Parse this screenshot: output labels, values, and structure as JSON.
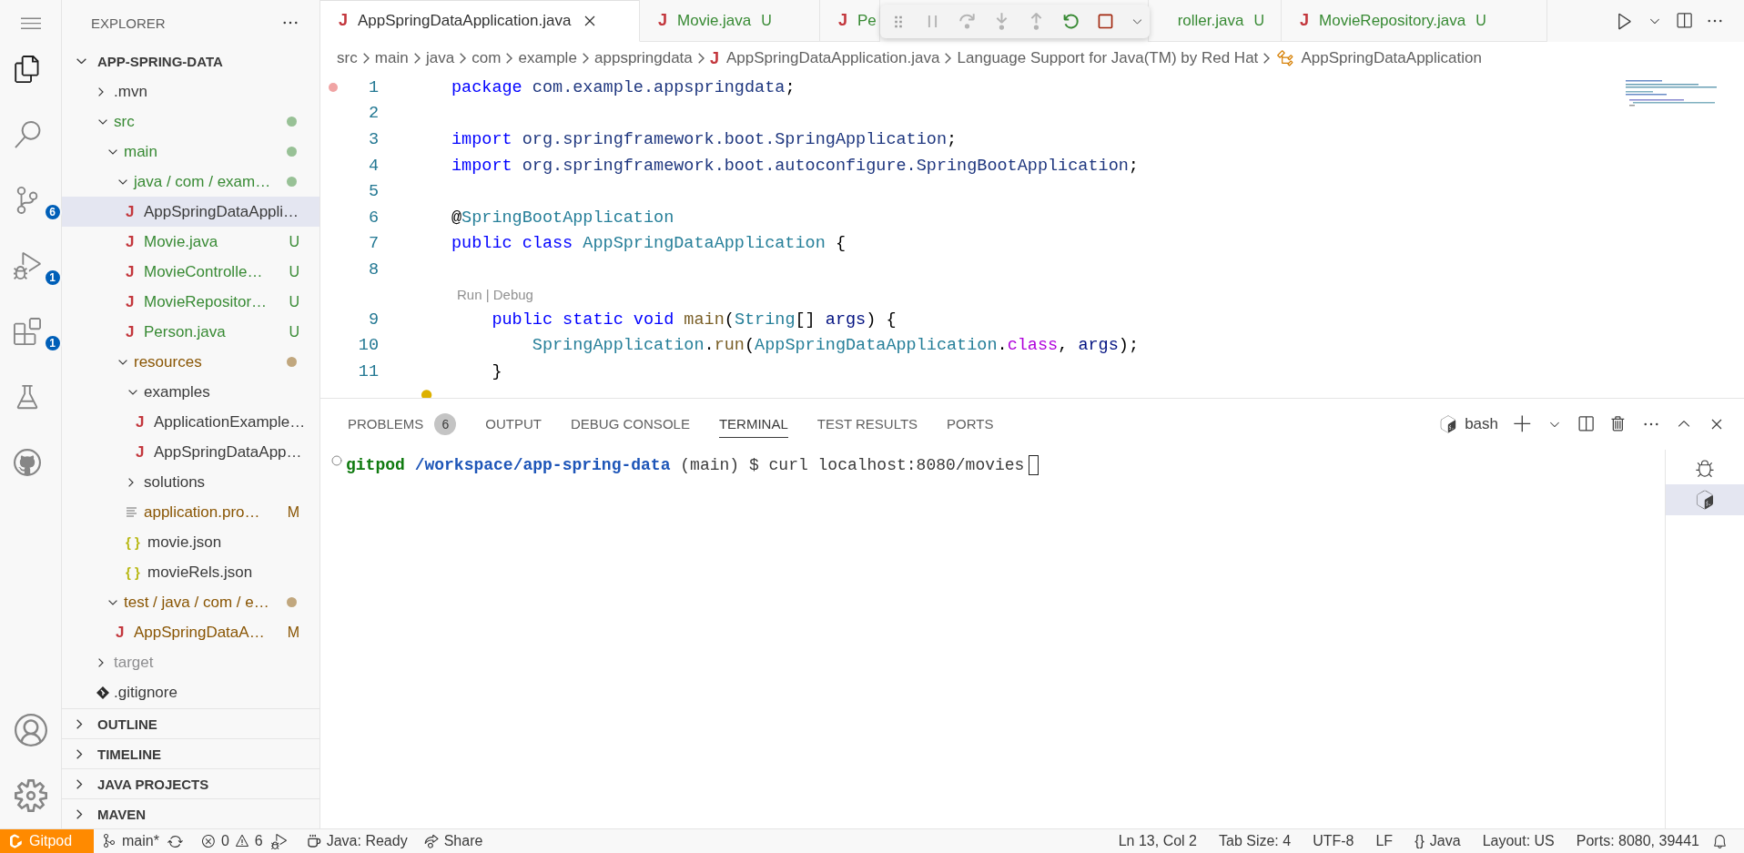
{
  "activity_bar": {
    "items": [
      {
        "kind": "explorer",
        "selected": true
      },
      {
        "kind": "search",
        "selected": false
      },
      {
        "kind": "source_control",
        "selected": false,
        "badge": "6"
      },
      {
        "kind": "run_debug",
        "selected": false,
        "badge": "1"
      },
      {
        "kind": "extensions",
        "selected": false,
        "badge": "1"
      },
      {
        "kind": "testing",
        "selected": false
      },
      {
        "kind": "github",
        "selected": false
      }
    ],
    "bottom": [
      {
        "kind": "accounts"
      },
      {
        "kind": "settings"
      }
    ]
  },
  "explorer": {
    "title": "EXPLORER",
    "root": {
      "label": "APP-SPRING-DATA",
      "expanded": true
    },
    "tree": [
      {
        "kind": "folder",
        "label": ".mvn",
        "expanded": false,
        "selected": false,
        "color": "#3b3b3b",
        "dot": false
      },
      {
        "kind": "folder",
        "label": "src",
        "expanded": true,
        "selected": false,
        "color": "#388a34",
        "dot": true,
        "children": [
          {
            "kind": "folder",
            "label": "main",
            "expanded": true,
            "selected": false,
            "color": "#388a34",
            "dot": true,
            "children": [
              {
                "kind": "folder",
                "label": "java / com / exam…",
                "expanded": true,
                "selected": false,
                "color": "#388a34",
                "dot": true,
                "children": [
                  {
                    "kind": "java",
                    "icon": "J",
                    "label": "AppSpringDataAppli…",
                    "selected": true,
                    "color": "#3b3b3b",
                    "dot": false
                  },
                  {
                    "kind": "java",
                    "icon": "J",
                    "label": "Movie.java",
                    "selected": false,
                    "color": "#388a34",
                    "dot": false,
                    "badge": "U"
                  },
                  {
                    "kind": "java",
                    "icon": "J",
                    "label": "MovieControlle…",
                    "selected": false,
                    "color": "#388a34",
                    "dot": false,
                    "badge": "U"
                  },
                  {
                    "kind": "java",
                    "icon": "J",
                    "label": "MovieRepositor…",
                    "selected": false,
                    "color": "#388a34",
                    "dot": false,
                    "badge": "U"
                  },
                  {
                    "kind": "java",
                    "icon": "J",
                    "label": "Person.java",
                    "selected": false,
                    "color": "#388a34",
                    "dot": false,
                    "badge": "U"
                  }
                ]
              },
              {
                "kind": "folder",
                "label": "resources",
                "expanded": true,
                "selected": false,
                "color": "#895503",
                "dot": true,
                "children": [
                  {
                    "kind": "folder",
                    "label": "examples",
                    "expanded": true,
                    "selected": false,
                    "color": "#3b3b3b",
                    "dot": false,
                    "children": [
                      {
                        "kind": "java",
                        "icon": "J",
                        "label": "ApplicationExample…",
                        "selected": false,
                        "color": "#3b3b3b",
                        "dot": false
                      },
                      {
                        "kind": "java",
                        "icon": "J",
                        "label": "AppSpringDataApp…",
                        "selected": false,
                        "color": "#3b3b3b",
                        "dot": false
                      }
                    ]
                  },
                  {
                    "kind": "folder",
                    "label": "solutions",
                    "expanded": false,
                    "selected": false,
                    "color": "#3b3b3b",
                    "dot": false
                  },
                  {
                    "kind": "properties",
                    "label": "application.pro…",
                    "selected": false,
                    "color": "#895503",
                    "dot": false,
                    "badge": "M"
                  },
                  {
                    "kind": "json",
                    "icon": "{ }",
                    "label": "movie.json",
                    "selected": false,
                    "color": "#3b3b3b",
                    "dot": false
                  },
                  {
                    "kind": "json",
                    "icon": "{ }",
                    "label": "movieRels.json",
                    "selected": false,
                    "color": "#3b3b3b",
                    "dot": false
                  }
                ]
              }
            ]
          },
          {
            "kind": "folder",
            "label": "test / java / com / e…",
            "expanded": true,
            "selected": false,
            "color": "#895503",
            "dot": true,
            "children": [
              {
                "kind": "java",
                "icon": "J",
                "label": "AppSpringDataA…",
                "selected": false,
                "color": "#895503",
                "dot": false,
                "badge": "M"
              }
            ]
          }
        ]
      },
      {
        "kind": "folder",
        "label": "target",
        "expanded": false,
        "selected": false,
        "color": "#8e8e90",
        "dot": false
      },
      {
        "kind": "git",
        "label": ".gitignore",
        "selected": false,
        "color": "#3b3b3b",
        "dot": false
      }
    ],
    "sections": [
      {
        "label": "OUTLINE",
        "expanded": false
      },
      {
        "label": "TIMELINE",
        "expanded": false
      },
      {
        "label": "JAVA PROJECTS",
        "expanded": false
      },
      {
        "label": "MAVEN",
        "expanded": false
      }
    ]
  },
  "tabs": [
    {
      "icon": "J",
      "label": "AppSpringDataApplication.java",
      "selected": true,
      "color": "#333333"
    },
    {
      "icon": "J",
      "label": "Movie.java",
      "badge": "U",
      "selected": false,
      "color": "#388a34"
    },
    {
      "icon": "J",
      "label": "Pe",
      "selected": false,
      "color": "#388a34"
    },
    {
      "label": "roller.java",
      "badge": "U",
      "selected": false,
      "color": "#388a34"
    },
    {
      "icon": "J",
      "label": "MovieRepository.java",
      "badge": "U",
      "selected": false,
      "color": "#388a34"
    }
  ],
  "debug_toolbar": {
    "buttons": [
      {
        "kind": "pause",
        "disabled": true
      },
      {
        "kind": "step_over",
        "disabled": true
      },
      {
        "kind": "step_into",
        "disabled": true
      },
      {
        "kind": "step_out",
        "disabled": true
      },
      {
        "kind": "restart",
        "disabled": false
      },
      {
        "kind": "stop",
        "disabled": false
      }
    ]
  },
  "breadcrumbs": [
    {
      "kind": "segment",
      "label": "src"
    },
    {
      "kind": "segment",
      "label": "main"
    },
    {
      "kind": "segment",
      "label": "java"
    },
    {
      "kind": "segment",
      "label": "com"
    },
    {
      "kind": "segment",
      "label": "example"
    },
    {
      "kind": "segment",
      "label": "appspringdata"
    },
    {
      "kind": "file",
      "icon": "J",
      "label": "AppSpringDataApplication.java"
    },
    {
      "kind": "segment",
      "label": "Language Support for Java(TM) by Red Hat"
    },
    {
      "kind": "symbol",
      "label": "AppSpringDataApplication"
    }
  ],
  "code": [
    {
      "kind": "code",
      "number": "1",
      "breakpoint": true,
      "tokens": [
        {
          "text": "package",
          "kind": "keyword"
        },
        {
          "text": " com.example.appspringdata",
          "kind": "name"
        },
        {
          "text": ";",
          "kind": "plain"
        }
      ]
    },
    {
      "kind": "code",
      "number": "2",
      "breakpoint": false
    },
    {
      "kind": "code",
      "number": "3",
      "breakpoint": false,
      "tokens": [
        {
          "text": "import",
          "kind": "keyword"
        },
        {
          "text": " org.springframework.boot.SpringApplication",
          "kind": "name"
        },
        {
          "text": ";",
          "kind": "plain"
        }
      ]
    },
    {
      "kind": "code",
      "number": "4",
      "breakpoint": false,
      "tokens": [
        {
          "text": "import",
          "kind": "keyword"
        },
        {
          "text": " org.springframework.boot.autoconfigure.SpringBootApplication",
          "kind": "name"
        },
        {
          "text": ";",
          "kind": "plain"
        }
      ]
    },
    {
      "kind": "code",
      "number": "5",
      "breakpoint": false
    },
    {
      "kind": "code",
      "number": "6",
      "breakpoint": false,
      "tokens": [
        {
          "text": "@",
          "kind": "plain"
        },
        {
          "text": "SpringBootApplication",
          "kind": "type"
        }
      ]
    },
    {
      "kind": "code",
      "number": "7",
      "breakpoint": false,
      "tokens": [
        {
          "text": "public class",
          "kind": "keyword"
        },
        {
          "text": " AppSpringDataApplication",
          "kind": "type"
        },
        {
          "text": " {",
          "kind": "plain"
        }
      ]
    },
    {
      "kind": "code",
      "number": "8",
      "breakpoint": false
    },
    {
      "kind": "codelens",
      "text": "Run | Debug"
    },
    {
      "kind": "code",
      "number": "9",
      "breakpoint": false,
      "tokens": [
        {
          "text": "    public static void",
          "kind": "keyword"
        },
        {
          "text": " main",
          "kind": "func"
        },
        {
          "text": "(",
          "kind": "plain"
        },
        {
          "text": "String",
          "kind": "type"
        },
        {
          "text": "[] ",
          "kind": "plain"
        },
        {
          "text": "args",
          "kind": "variable"
        },
        {
          "text": ") {",
          "kind": "plain"
        }
      ]
    },
    {
      "kind": "code",
      "number": "10",
      "breakpoint": false,
      "tokens": [
        {
          "text": "        SpringApplication",
          "kind": "type"
        },
        {
          "text": ".",
          "kind": "plain"
        },
        {
          "text": "run",
          "kind": "func"
        },
        {
          "text": "(",
          "kind": "plain"
        },
        {
          "text": "AppSpringDataApplication",
          "kind": "type"
        },
        {
          "text": ".",
          "kind": "plain"
        },
        {
          "text": "class",
          "kind": "control"
        },
        {
          "text": ", ",
          "kind": "plain"
        },
        {
          "text": "args",
          "kind": "variable"
        },
        {
          "text": ");",
          "kind": "plain"
        }
      ]
    },
    {
      "kind": "code",
      "number": "11",
      "breakpoint": false,
      "tokens": [
        {
          "text": "    }",
          "kind": "plain"
        }
      ]
    },
    {
      "kind": "hint"
    }
  ],
  "panel": {
    "tabs": [
      {
        "label": "PROBLEMS",
        "badge": "6",
        "selected": false
      },
      {
        "label": "OUTPUT",
        "selected": false
      },
      {
        "label": "DEBUG CONSOLE",
        "selected": false
      },
      {
        "label": "TERMINAL",
        "selected": true
      },
      {
        "label": "TEST RESULTS",
        "selected": false
      },
      {
        "label": "PORTS",
        "selected": false
      }
    ],
    "shell": "bash",
    "terminal": {
      "user": "gitpod",
      "path": "/workspace/app-spring-data",
      "branch": "(main)",
      "symbol": "$",
      "command": "curl localhost:8080/movies"
    },
    "terminal_list": [
      {
        "kind": "debug",
        "selected": false
      },
      {
        "kind": "bash",
        "selected": true
      }
    ]
  },
  "status_bar": {
    "remote": "Gitpod",
    "branch": "main*",
    "errors": "0",
    "warnings": "6",
    "java": "Java: Ready",
    "share": "Share",
    "right": [
      {
        "kind": "text",
        "text": "Ln 13, Col 2"
      },
      {
        "kind": "text",
        "text": "Tab Size: 4"
      },
      {
        "kind": "text",
        "text": "UTF-8"
      },
      {
        "kind": "text",
        "text": "LF"
      },
      {
        "kind": "language",
        "icon": "{}",
        "text": "Java"
      },
      {
        "kind": "text",
        "text": "Layout: US"
      },
      {
        "kind": "text",
        "text": "Ports: 8080, 39441"
      }
    ]
  }
}
